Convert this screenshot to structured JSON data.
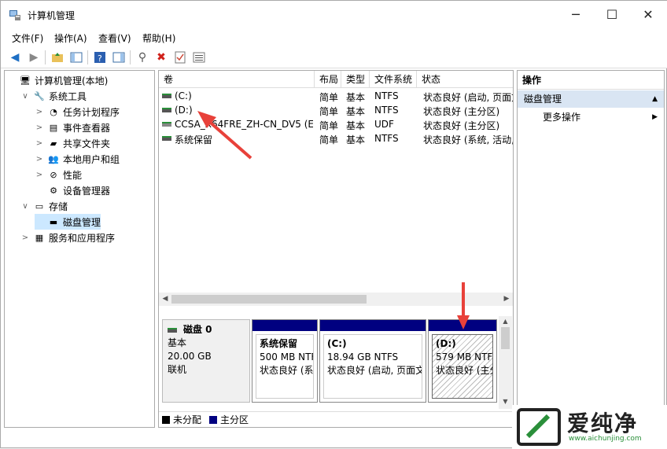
{
  "window": {
    "title": "计算机管理"
  },
  "menu": [
    "文件(F)",
    "操作(A)",
    "查看(V)",
    "帮助(H)"
  ],
  "tree": [
    {
      "label": "计算机管理(本地)",
      "indent": 0,
      "twisty": "",
      "icon": "computer-mgmt-icon"
    },
    {
      "label": "系统工具",
      "indent": 1,
      "twisty": "∨",
      "icon": "tools-icon"
    },
    {
      "label": "任务计划程序",
      "indent": 2,
      "twisty": ">",
      "icon": "clock-icon"
    },
    {
      "label": "事件查看器",
      "indent": 2,
      "twisty": ">",
      "icon": "event-viewer-icon"
    },
    {
      "label": "共享文件夹",
      "indent": 2,
      "twisty": ">",
      "icon": "shared-folder-icon"
    },
    {
      "label": "本地用户和组",
      "indent": 2,
      "twisty": ">",
      "icon": "users-icon"
    },
    {
      "label": "性能",
      "indent": 2,
      "twisty": ">",
      "icon": "performance-icon"
    },
    {
      "label": "设备管理器",
      "indent": 2,
      "twisty": "",
      "icon": "device-manager-icon"
    },
    {
      "label": "存储",
      "indent": 1,
      "twisty": "∨",
      "icon": "storage-icon"
    },
    {
      "label": "磁盘管理",
      "indent": 2,
      "twisty": "",
      "icon": "disk-mgmt-icon",
      "selected": true
    },
    {
      "label": "服务和应用程序",
      "indent": 1,
      "twisty": ">",
      "icon": "services-icon"
    }
  ],
  "columns": [
    "卷",
    "布局",
    "类型",
    "文件系统",
    "状态"
  ],
  "volumes": [
    {
      "name": "(C:)",
      "layout": "简单",
      "type": "基本",
      "fs": "NTFS",
      "status": "状态良好 (启动, 页面文"
    },
    {
      "name": "(D:)",
      "layout": "简单",
      "type": "基本",
      "fs": "NTFS",
      "status": "状态良好 (主分区)"
    },
    {
      "name": "CCSA_X64FRE_ZH-CN_DV5 (E:)",
      "layout": "简单",
      "type": "基本",
      "fs": "UDF",
      "status": "状态良好 (主分区)"
    },
    {
      "name": "系统保留",
      "layout": "简单",
      "type": "基本",
      "fs": "NTFS",
      "status": "状态良好 (系统, 活动,"
    }
  ],
  "disk": {
    "name": "磁盘 0",
    "kind": "基本",
    "size": "20.00 GB",
    "state": "联机",
    "partitions": [
      {
        "name": "系统保留",
        "detail": "500 MB NTF",
        "status": "状态良好 (系"
      },
      {
        "name": "(C:)",
        "detail": "18.94 GB NTFS",
        "status": "状态良好 (启动, 页面文"
      },
      {
        "name": "(D:)",
        "detail": "579 MB NTF",
        "status": "状态良好 (主分"
      }
    ]
  },
  "legend": [
    {
      "label": "未分配",
      "color": "#000000"
    },
    {
      "label": "主分区",
      "color": "#000080"
    }
  ],
  "actions": {
    "title": "操作",
    "section": "磁盘管理",
    "more": "更多操作"
  },
  "watermark": {
    "text": "爱纯净",
    "url": "www.aichunjing.com"
  }
}
